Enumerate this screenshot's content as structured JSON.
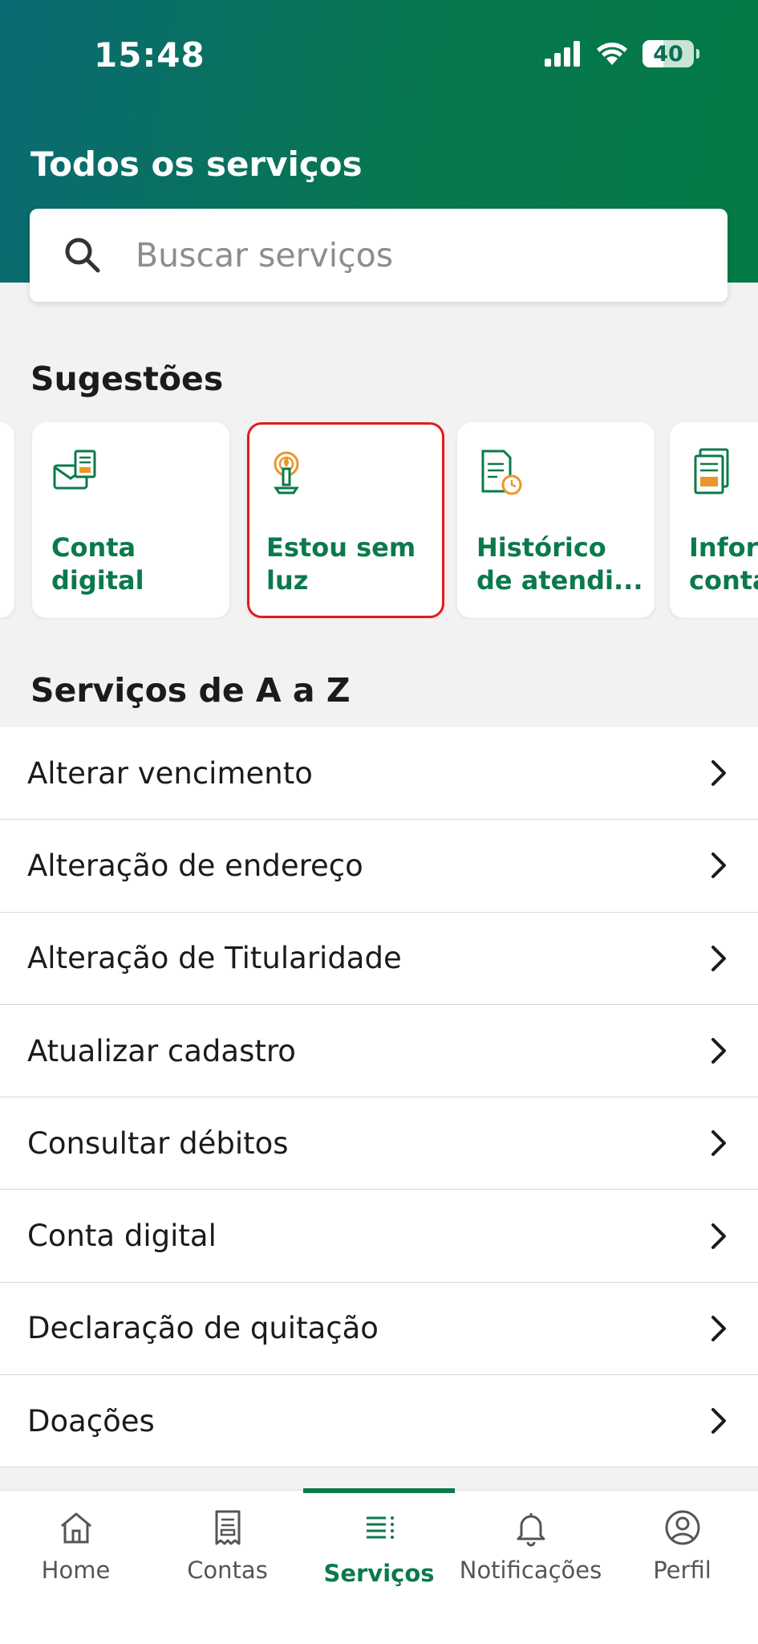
{
  "status": {
    "time": "15:48",
    "battery": "40"
  },
  "header": {
    "title": "Todos os serviços"
  },
  "search": {
    "placeholder": "Buscar serviços",
    "icon": "search-icon"
  },
  "suggestions": {
    "title": "Sugestões",
    "items": [
      {
        "label": "Conta\ndigital",
        "icon": "envelope-bill-icon"
      },
      {
        "label": "Estou sem\nluz",
        "icon": "candle-icon",
        "highlighted": true
      },
      {
        "label": "Histórico\nde atendi...",
        "icon": "document-clock-icon"
      },
      {
        "label": "Infor\nconta",
        "icon": "invoice-icon"
      }
    ]
  },
  "az": {
    "title": "Serviços de A a Z",
    "items": [
      "Alterar vencimento",
      "Alteração de endereço",
      "Alteração de Titularidade",
      "Atualizar cadastro",
      "Consultar débitos",
      "Conta digital",
      "Declaração de quitação",
      "Doações"
    ]
  },
  "tabs": [
    {
      "label": "Home",
      "icon": "home-icon"
    },
    {
      "label": "Contas",
      "icon": "receipt-icon"
    },
    {
      "label": "Serviços",
      "icon": "services-list-icon",
      "active": true
    },
    {
      "label": "Notificações",
      "icon": "bell-icon"
    },
    {
      "label": "Perfil",
      "icon": "user-circle-icon"
    }
  ],
  "colors": {
    "accent": "#0b7a4b",
    "icon_orange": "#e8962a",
    "highlight": "#e21b1b"
  }
}
